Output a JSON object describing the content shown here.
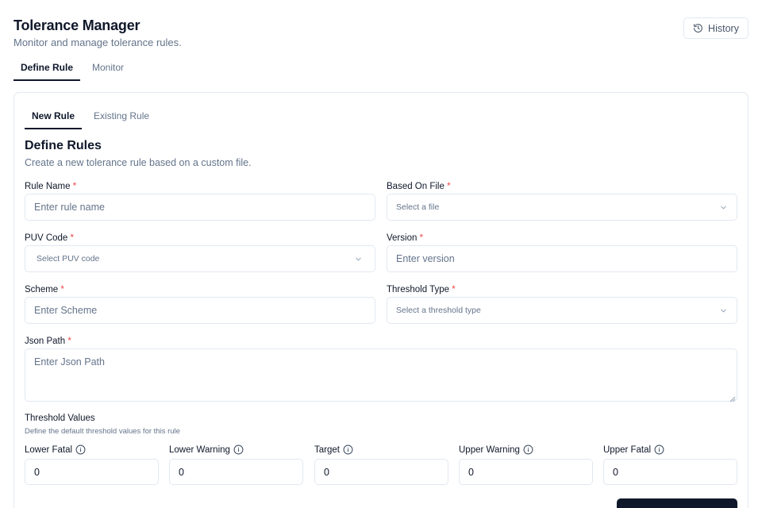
{
  "header": {
    "title": "Tolerance Manager",
    "subtitle": "Monitor and manage tolerance rules.",
    "history_label": "History"
  },
  "top_tabs": [
    {
      "label": "Define Rule",
      "active": true
    },
    {
      "label": "Monitor",
      "active": false
    }
  ],
  "inner_tabs": [
    {
      "label": "New Rule",
      "active": true
    },
    {
      "label": "Existing Rule",
      "active": false
    }
  ],
  "form": {
    "title": "Define Rules",
    "subtitle": "Create a new tolerance rule based on a custom file.",
    "required_marker": "*",
    "rule_name": {
      "label": "Rule Name",
      "placeholder": "Enter rule name"
    },
    "based_on_file": {
      "label": "Based On File",
      "placeholder": "Select a file"
    },
    "puv_code": {
      "label": "PUV Code",
      "placeholder": "Select PUV code"
    },
    "version": {
      "label": "Version",
      "placeholder": "Enter version"
    },
    "scheme": {
      "label": "Scheme",
      "placeholder": "Enter Scheme"
    },
    "threshold_type": {
      "label": "Threshold Type",
      "placeholder": "Select a threshold type"
    },
    "json_path": {
      "label": "Json Path",
      "placeholder": "Enter Json Path"
    }
  },
  "threshold_values": {
    "title": "Threshold Values",
    "subtitle": "Define the default threshold values for this rule",
    "fields": [
      {
        "label": "Lower Fatal",
        "value": "0"
      },
      {
        "label": "Lower Warning",
        "value": "0"
      },
      {
        "label": "Target",
        "value": "0"
      },
      {
        "label": "Upper Warning",
        "value": "0"
      },
      {
        "label": "Upper Fatal",
        "value": "0"
      }
    ]
  },
  "colors": {
    "primary": "#0f172a",
    "muted_text": "#64748b",
    "border": "#e2e8f0",
    "required": "#ef4444"
  },
  "icons": {
    "history": "history-icon",
    "chevron": "chevron-down-icon",
    "info": "info-icon"
  }
}
